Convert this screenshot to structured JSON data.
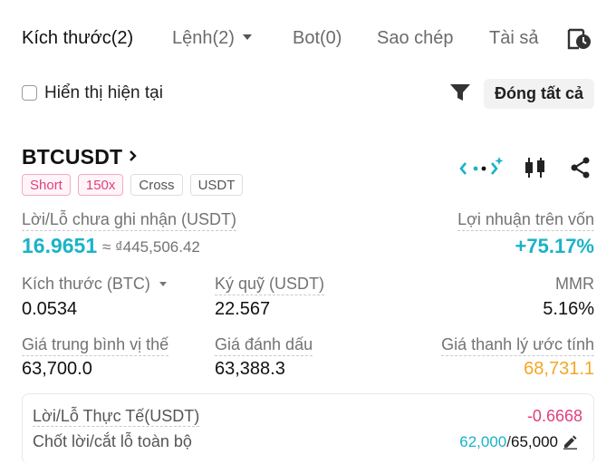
{
  "tabs": {
    "positions": "Kích thước(2)",
    "orders": "Lệnh(2)",
    "bots": "Bot(0)",
    "copy": "Sao chép",
    "assets": "Tài sả"
  },
  "filter": {
    "show_current": "Hiển thị hiện tại",
    "close_all": "Đóng tất cả"
  },
  "position": {
    "symbol": "BTCUSDT",
    "tags": [
      "Short",
      "150x",
      "Cross",
      "USDT"
    ],
    "unrealized_pnl_label": "Lời/Lỗ chưa ghi nhận (USDT)",
    "unrealized_pnl": "16.9651",
    "unrealized_pnl_converted": "≈ ₫445,506.42",
    "roe_label": "Lợi nhuận trên vốn",
    "roe": "+75.17%",
    "size_label": "Kích thước (BTC)",
    "size": "0.0534",
    "margin_label": "Ký quỹ (USDT)",
    "margin": "22.567",
    "mmr_label": "MMR",
    "mmr": "5.16%",
    "entry_label": "Giá trung bình vị thế",
    "entry": "63,700.0",
    "mark_label": "Giá đánh dấu",
    "mark": "63,388.3",
    "liq_label": "Giá thanh lý ước tính",
    "liq": "68,731.1",
    "realized_label": "Lời/Lỗ Thực Tế(USDT)",
    "realized": "-0.6668",
    "tpsl_label": "Chốt lời/cắt lỗ toàn bộ",
    "tp": "62,000",
    "tp_sep": "/",
    "sl": "65,000"
  },
  "colors": {
    "teal": "#1ab3c8",
    "pink": "#e0407d",
    "orange": "#f5a623"
  },
  "icons": [
    "history-clock-icon",
    "filter-icon",
    "chevron-right-icon",
    "trading-bot-icon",
    "candlestick-chart-icon",
    "share-icon",
    "edit-icon"
  ]
}
